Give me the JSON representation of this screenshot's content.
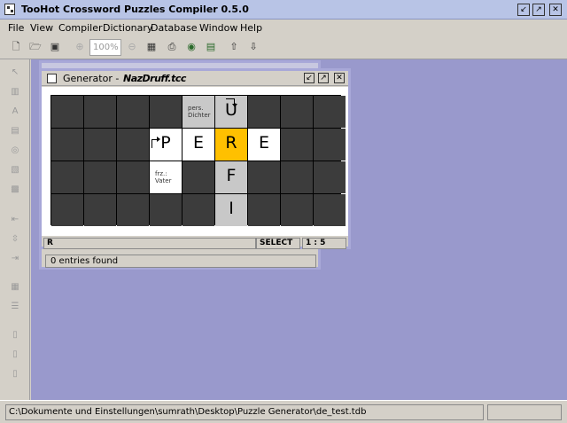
{
  "app": {
    "title": "TooHot Crossword Puzzles Compiler 0.5.0",
    "window_controls": [
      "↙",
      "↗",
      "✕"
    ]
  },
  "menubar": {
    "items": [
      {
        "label": "File"
      },
      {
        "label": "View"
      },
      {
        "label": "Compiler"
      },
      {
        "label": "Dictionary"
      },
      {
        "label": "Database"
      },
      {
        "label": "Window"
      },
      {
        "label": "Help"
      }
    ]
  },
  "toolbar": {
    "zoom_value": "100%",
    "icons": [
      "new-icon",
      "open-icon",
      "save-icon",
      "zoom-in-icon",
      "zoom-out-icon",
      "grid-icon",
      "print-icon",
      "globe-icon",
      "dictionary-icon",
      "database-icon",
      "export-icon",
      "import-icon"
    ]
  },
  "palette": {
    "tools": [
      "pointer",
      "block",
      "text",
      "clue",
      "rotate",
      "fill",
      "select-grid",
      "align-left",
      "align-center",
      "align-right",
      "table",
      "rows",
      "col-a",
      "col-b",
      "col-c"
    ]
  },
  "background_window": {
    "status": "0 entries found"
  },
  "generator": {
    "title": "Generator -",
    "file": "NazDruff.tcc",
    "status_left": "R",
    "status_mode": "SELECT",
    "status_pos": "1 : 5",
    "grid": {
      "rows": 4,
      "cols": 9,
      "cells": [
        {
          "r": 0,
          "c": 4,
          "type": "grey",
          "clue": "pers.\nDichter"
        },
        {
          "r": 0,
          "c": 5,
          "type": "grey",
          "letter": "U",
          "arrow": "down"
        },
        {
          "r": 1,
          "c": 3,
          "type": "white",
          "letter": "P",
          "arrow": "right"
        },
        {
          "r": 1,
          "c": 4,
          "type": "white",
          "letter": "E"
        },
        {
          "r": 1,
          "c": 5,
          "type": "hl",
          "letter": "R"
        },
        {
          "r": 1,
          "c": 6,
          "type": "white",
          "letter": "E"
        },
        {
          "r": 2,
          "c": 3,
          "type": "white",
          "clue": "frz.:\nVater"
        },
        {
          "r": 2,
          "c": 5,
          "type": "grey",
          "letter": "F"
        },
        {
          "r": 3,
          "c": 5,
          "type": "grey",
          "letter": "I"
        }
      ]
    }
  },
  "statusbar": {
    "path": "C:\\Dokumente und Einstellungen\\sumrath\\Desktop\\Puzzle Generator\\de_test.tdb"
  },
  "colors": {
    "desktop": "#9999cc",
    "highlight": "#ffc000",
    "block": "#3c3c3c"
  }
}
